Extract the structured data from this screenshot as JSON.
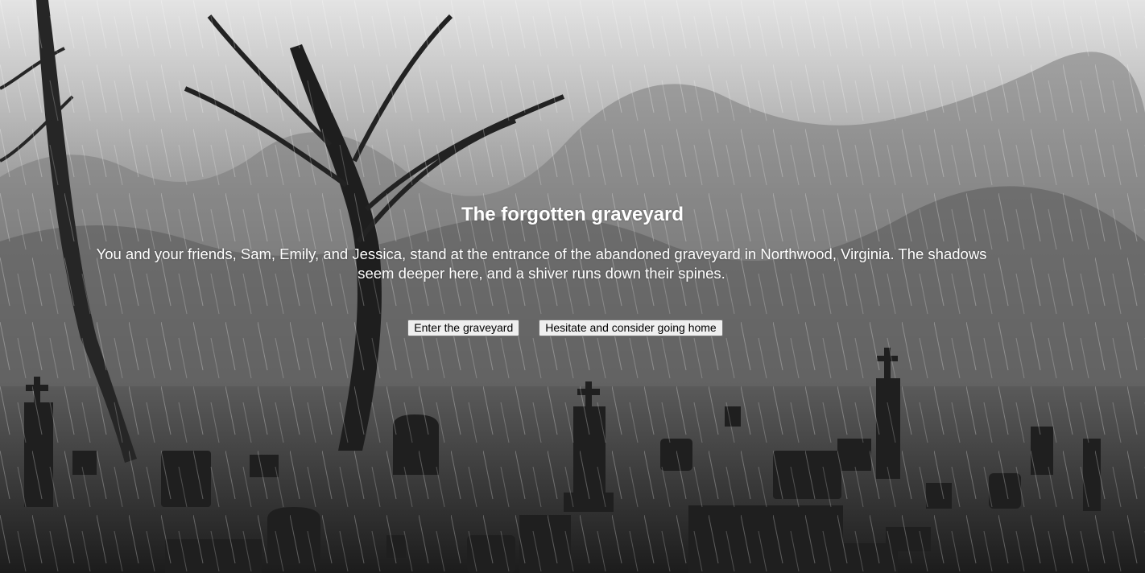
{
  "scene": {
    "title": "The forgotten graveyard",
    "story": "You and your friends, Sam, Emily, and Jessica, stand at the entrance of the abandoned graveyard in Northwood, Virginia. The shadows seem deeper here, and a shiver runs down their spines."
  },
  "choices": [
    {
      "label": "Enter the graveyard"
    },
    {
      "label": "Hesitate and consider going home"
    }
  ],
  "background": {
    "icon": "rainy-graveyard-background",
    "palette": [
      "#cfcfcf",
      "#8f8f8f",
      "#4b4b4b",
      "#1e1e1e"
    ]
  }
}
